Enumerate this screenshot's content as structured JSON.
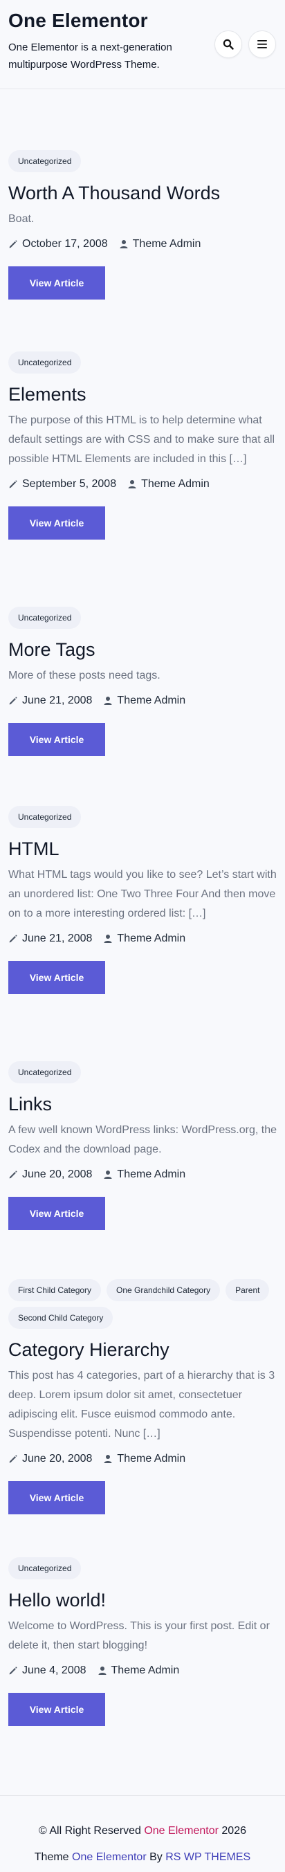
{
  "site": {
    "title": "One Elementor",
    "tagline": "One Elementor is a next-generation multipurpose WordPress Theme."
  },
  "header": {
    "search_icon": "search-icon",
    "menu_icon": "hamburger-menu-icon"
  },
  "posts": [
    {
      "categories": [
        "Uncategorized"
      ],
      "title": "Worth A Thousand Words",
      "excerpt": "Boat.",
      "date": "October 17, 2008",
      "author": "Theme Admin",
      "button": "View Article"
    },
    {
      "categories": [
        "Uncategorized"
      ],
      "title": "Elements",
      "excerpt": "The purpose of this HTML is to help determine what default settings are with CSS and to make sure that all possible HTML Elements are included in this […]",
      "date": "September 5, 2008",
      "author": "Theme Admin",
      "button": "View Article"
    },
    {
      "categories": [
        "Uncategorized"
      ],
      "title": "More Tags",
      "excerpt": "More of these posts need tags.",
      "date": "June 21, 2008",
      "author": "Theme Admin",
      "button": "View Article"
    },
    {
      "categories": [
        "Uncategorized"
      ],
      "title": "HTML",
      "excerpt": "What HTML tags would you like to see? Let’s start with an unordered list: One Two Three Four And then move on to a more interesting ordered list: […]",
      "date": "June 21, 2008",
      "author": "Theme Admin",
      "button": "View Article"
    },
    {
      "categories": [
        "Uncategorized"
      ],
      "title": "Links",
      "excerpt": "A few well known WordPress links: WordPress.org, the Codex and the download page.",
      "date": "June 20, 2008",
      "author": "Theme Admin",
      "button": "View Article"
    },
    {
      "categories": [
        "First Child Category",
        "One Grandchild Category",
        "Parent",
        "Second Child Category"
      ],
      "title": "Category Hierarchy",
      "excerpt": "This post has 4 categories, part of a hierarchy that is 3 deep. Lorem ipsum dolor sit amet, consectetuer adipiscing elit. Fusce euismod commodo ante. Suspendisse potenti. Nunc […]",
      "date": "June 20, 2008",
      "author": "Theme Admin",
      "button": "View Article"
    },
    {
      "categories": [
        "Uncategorized"
      ],
      "title": "Hello world!",
      "excerpt": "Welcome to WordPress. This is your first post. Edit or delete it, then start blogging!",
      "date": "June 4, 2008",
      "author": "Theme Admin",
      "button": "View Article"
    }
  ],
  "footer": {
    "copyright_prefix": "© All Right Reserved",
    "copyright_site": "One Elementor",
    "copyright_year": "2026",
    "theme_prefix": "Theme",
    "theme_name": "One Elementor",
    "by_text": "By",
    "author_link": "RS WP THEMES"
  },
  "colors": {
    "accent": "#5b5bd6",
    "footer_pink": "#c2185b",
    "footer_blue": "#3f3fb8",
    "tag_bg": "#eef0f7"
  }
}
